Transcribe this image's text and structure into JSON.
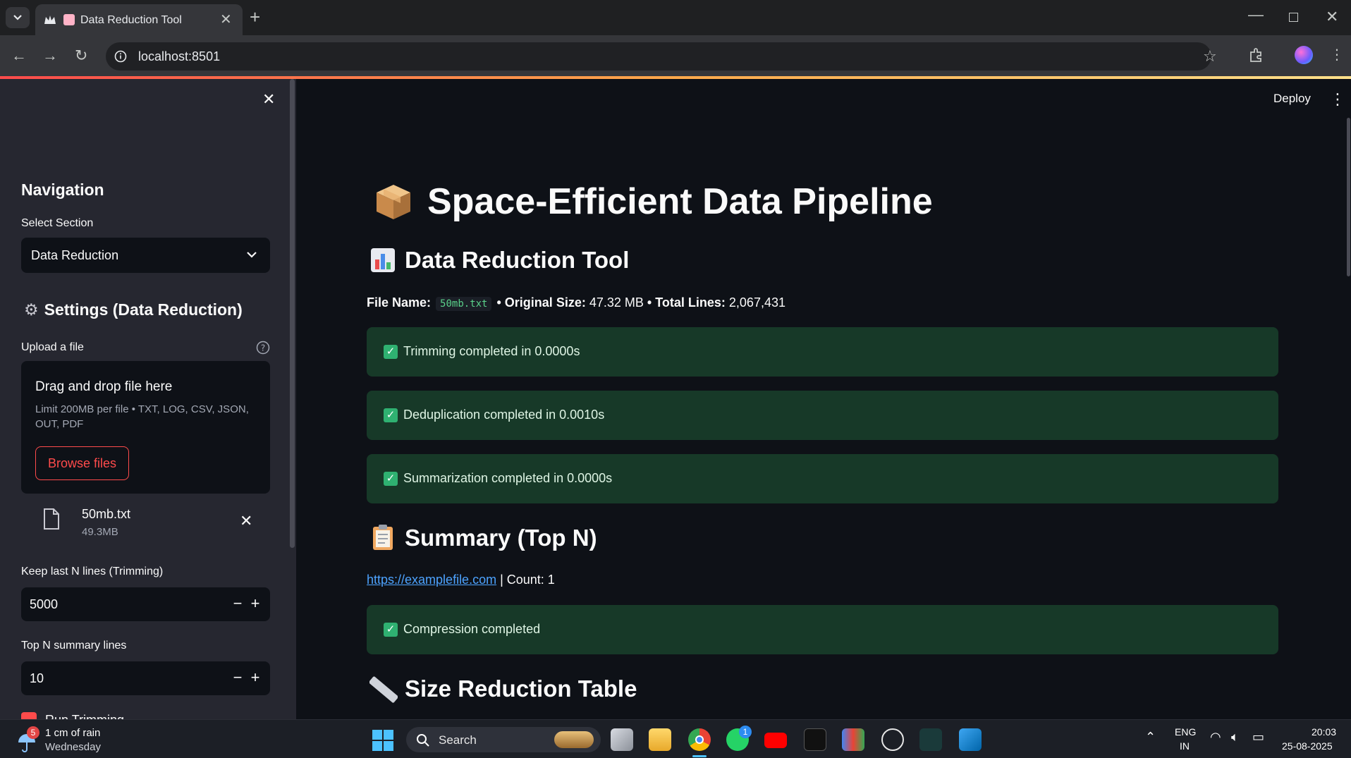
{
  "browser": {
    "tab_title": "Data Reduction Tool",
    "url": "localhost:8501"
  },
  "header": {
    "deploy_label": "Deploy"
  },
  "sidebar": {
    "nav_heading": "Navigation",
    "select_label": "Select Section",
    "select_value": "Data Reduction",
    "settings_heading": "Settings (Data Reduction)",
    "upload_label": "Upload a file",
    "dropzone_title": "Drag and drop file here",
    "dropzone_limit": "Limit 200MB per file • TXT, LOG, CSV, JSON, OUT, PDF",
    "browse_label": "Browse files",
    "file_name": "50mb.txt",
    "file_size": "49.3MB",
    "keep_label": "Keep last N lines (Trimming)",
    "keep_value": "5000",
    "topn_label": "Top N summary lines",
    "topn_value": "10",
    "dedup_label": "Run Trimming"
  },
  "main": {
    "title": "Space-Efficient Data Pipeline",
    "tool_heading": "Data Reduction Tool",
    "file_label": "File Name:",
    "file_code": "50mb.txt",
    "orig_label": "• Original Size:",
    "orig_value": "47.32 MB",
    "lines_label": "• Total Lines:",
    "lines_value": "2,067,431",
    "msg_trim": "Trimming completed in 0.0000s",
    "msg_dedup": "Deduplication completed in 0.0010s",
    "msg_sum": "Summarization completed in 0.0000s",
    "summary_heading": "Summary (Top N)",
    "summary_link": "https://examplefile.com",
    "summary_count": "| Count: 1",
    "msg_comp": "Compression completed",
    "table_heading": "Size Reduction Table"
  },
  "taskbar": {
    "weather_badge": "5",
    "weather_line1": "1 cm of rain",
    "weather_line2": "Wednesday",
    "search_label": "Search",
    "whatsapp_badge": "1",
    "lang_line1": "ENG",
    "lang_line2": "IN",
    "time": "20:03",
    "date": "25-08-2025"
  },
  "colors": {
    "accent": "#ff4b4b",
    "success_bg": "#173928",
    "link": "#4da3ff"
  }
}
